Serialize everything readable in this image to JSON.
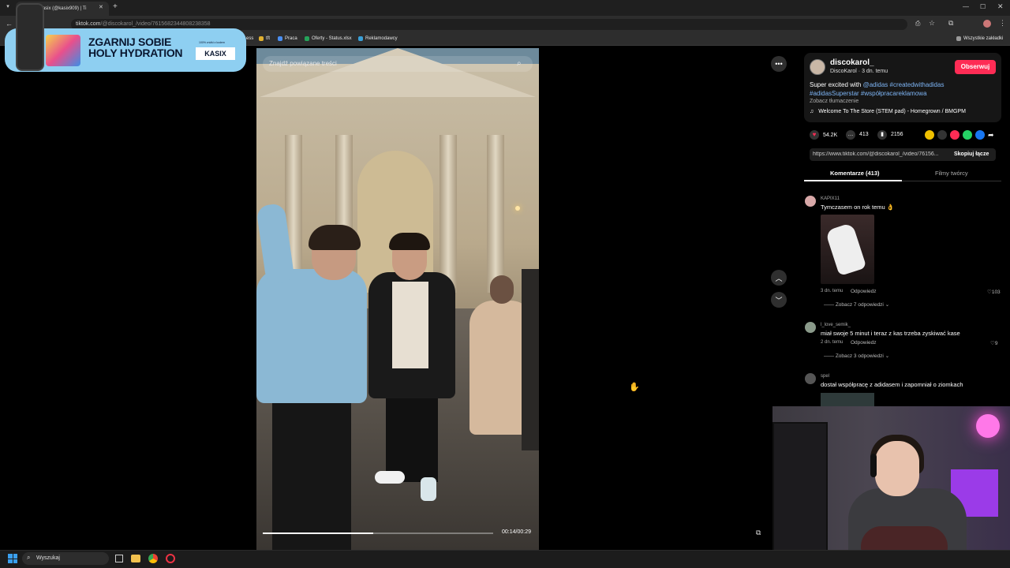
{
  "browser": {
    "tab_title": "(99+) Kasix (@kasix909) | Ti",
    "url_host": "tiktok.com",
    "url_path": "/@discokarol_/video/7615682344808238358",
    "bookmarks": [
      "ess",
      "tft",
      "Praca",
      "Oferty - Status.xlsx",
      "Reklamodawcy"
    ],
    "all_bookmarks": "Wszystkie zakładki"
  },
  "ad": {
    "title_line1": "ZGARNIJ SOBIE",
    "title_line2": "HOLY HYDRATION",
    "brand": "KASIX",
    "small": "100% zniżki z kodem"
  },
  "video": {
    "search_placeholder": "Znajdź powiązane treści",
    "time": "00:14/00:29",
    "progress": 0.48
  },
  "post": {
    "username": "discokarol_",
    "meta": "DiscoKarol · 3 dn. temu",
    "follow": "Obserwuj",
    "caption_prefix": "Super excited with ",
    "caption_tags_1": "@adidas #createdwithadidas",
    "caption_tags_2": "#adidasSuperstar #współpracareklamowa",
    "translate": "Zobacz tłumaczenie",
    "music": "Welcome To The Store (STEM pad) - Homegrown / BMGPM",
    "likes": "54.2K",
    "comments": "413",
    "saves": "2156",
    "link": "https://www.tiktok.com/@discokarol_/video/76156...",
    "copy_link": "Skopiuj łącze",
    "tab_comments": "Komentarze (413)",
    "tab_creator": "Filmy twórcy"
  },
  "comments": [
    {
      "user": "KAPIX11",
      "text": "Tymczasem on rok temu 👌",
      "time": "3 dn. temu",
      "reply": "Odpowiedz",
      "likes": "103",
      "more": "Zobacz 7 odpowiedzi"
    },
    {
      "user": "l_love_semik_",
      "text": "miał swoje 5 minut i teraz z kas trzeba zyskiwać kase",
      "time": "2 dn. temu",
      "reply": "Odpowiedz",
      "likes": "9",
      "more": "Zobacz 3 odpowiedzi"
    },
    {
      "user": "spel",
      "text": "dostał współpracę z adidasem i zapomniał o ziomkach"
    }
  ],
  "taskbar": {
    "search": "Wyszukaj"
  },
  "colors": {
    "accent": "#fe2c55",
    "link": "#7eb5f5",
    "ad_bg": "#8ecff1"
  }
}
